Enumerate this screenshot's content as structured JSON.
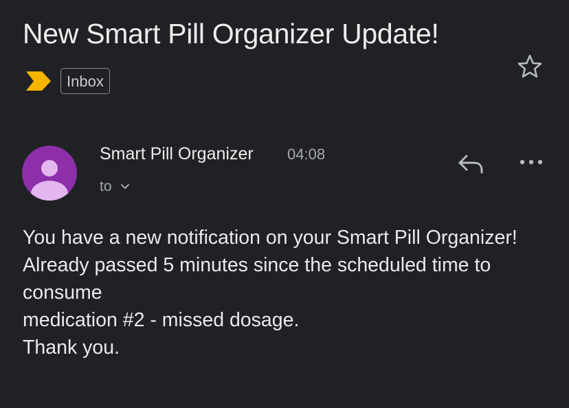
{
  "email": {
    "subject": "New Smart Pill Organizer Update!",
    "label": "Inbox",
    "sender_name": "Smart Pill Organizer",
    "time": "04:08",
    "recipient_prefix": "to",
    "body_lines": [
      "You have a new notification on your Smart Pill Organizer!",
      "Already passed 5 minutes since the scheduled time to consume",
      "medication #2 - missed dosage.",
      "Thank you."
    ]
  },
  "icons": {
    "importance": "importance-marker-icon",
    "star": "star-icon",
    "avatar": "person-avatar-icon",
    "recipient_expand": "chevron-down-icon",
    "reply": "reply-icon",
    "more": "more-horizontal-icon"
  },
  "colors": {
    "background": "#202124",
    "importance_marker": "#f5b400",
    "avatar_background": "#8c2fa9",
    "avatar_figure": "#e3b6ef",
    "primary_text": "#e8eaed",
    "secondary_text": "#a5a8ad"
  }
}
